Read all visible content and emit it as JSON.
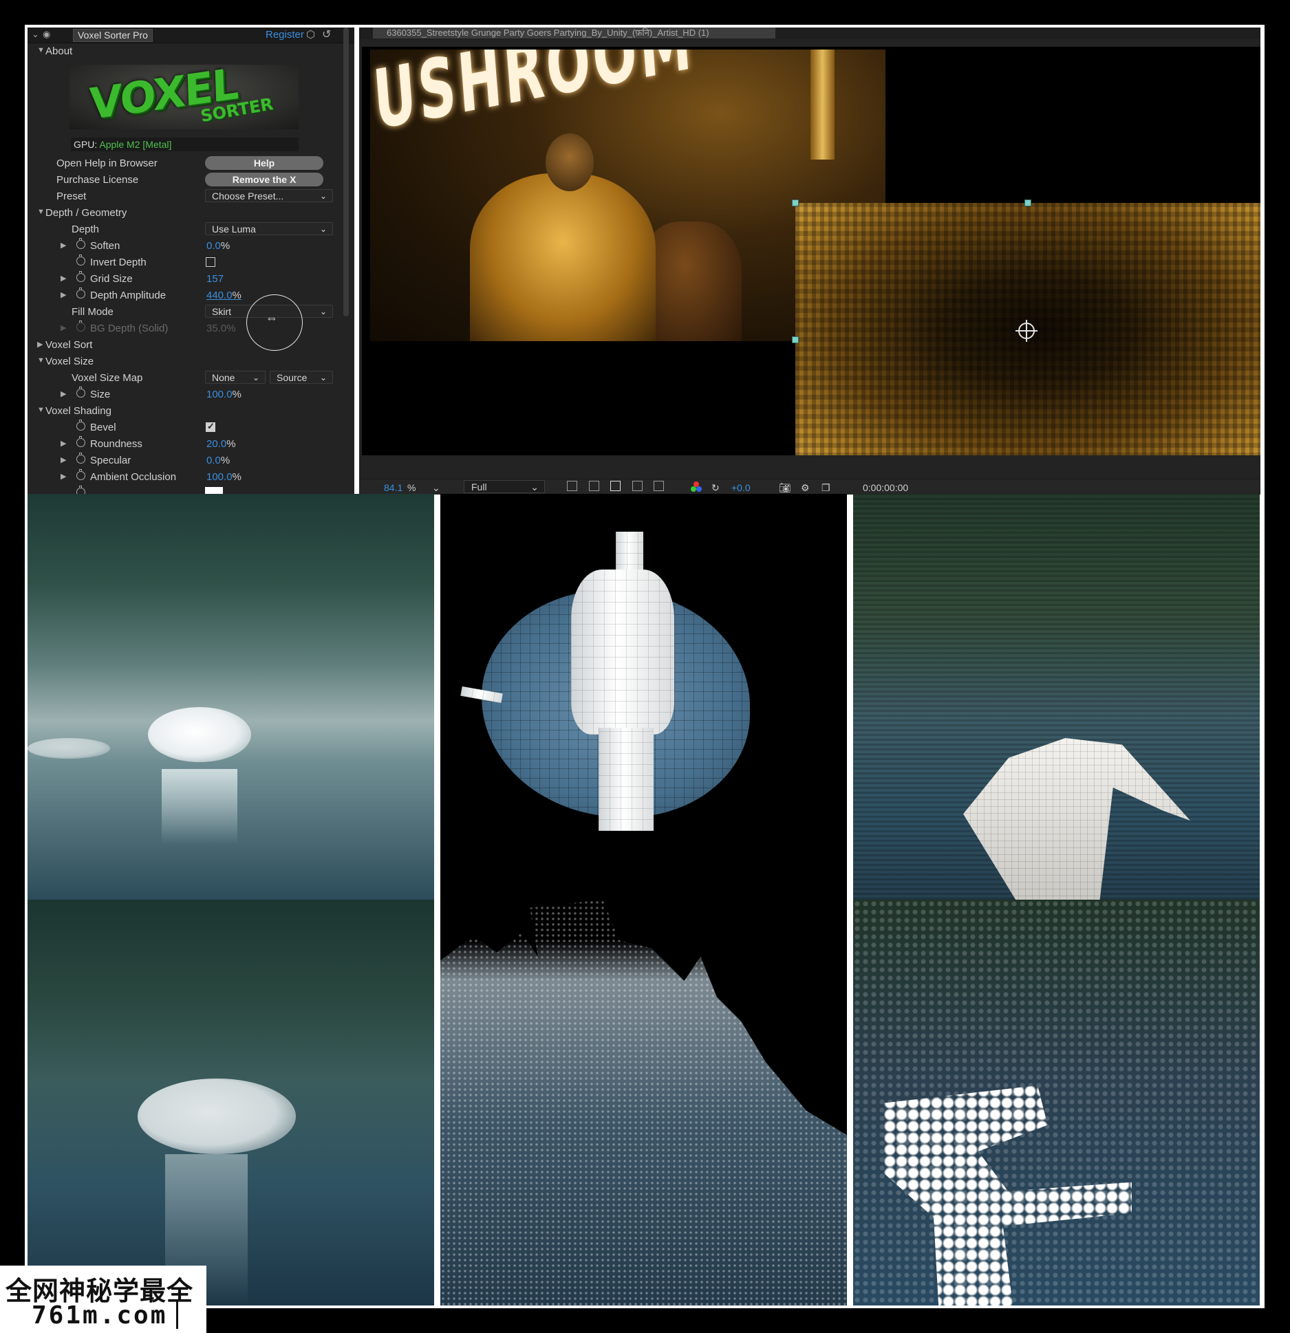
{
  "panel": {
    "title": "Voxel Sorter Pro",
    "register_label": "Register",
    "logo": {
      "word1": "VOXEL",
      "word2": "SORTER"
    },
    "gpu": {
      "label": "GPU:",
      "value": "Apple M2 [Metal]"
    },
    "rows": {
      "about": {
        "label": "About",
        "expanded": true
      },
      "open_help": {
        "label": "Open Help in Browser",
        "button": "Help"
      },
      "purchase": {
        "label": "Purchase License",
        "button": "Remove the X"
      },
      "preset": {
        "label": "Preset",
        "value": "Choose Preset..."
      },
      "depth_geometry": {
        "label": "Depth / Geometry",
        "expanded": true
      },
      "depth": {
        "label": "Depth",
        "value": "Use Luma"
      },
      "soften": {
        "label": "Soften",
        "value": "0.0",
        "unit": "%"
      },
      "invert_depth": {
        "label": "Invert Depth",
        "checked": false
      },
      "grid_size": {
        "label": "Grid Size",
        "value": "157"
      },
      "depth_amplitude": {
        "label": "Depth Amplitude",
        "value": "440.0",
        "unit": "%"
      },
      "fill_mode": {
        "label": "Fill Mode",
        "value": "Skirt"
      },
      "bg_depth": {
        "label": "BG Depth (Solid)",
        "value": "35.0",
        "unit": "%"
      },
      "voxel_sort": {
        "label": "Voxel Sort",
        "expanded": false
      },
      "voxel_size": {
        "label": "Voxel Size",
        "expanded": true
      },
      "voxel_size_map": {
        "label": "Voxel Size Map",
        "value1": "None",
        "value2": "Source"
      },
      "size": {
        "label": "Size",
        "value": "100.0",
        "unit": "%"
      },
      "voxel_shading": {
        "label": "Voxel Shading",
        "expanded": true
      },
      "bevel": {
        "label": "Bevel",
        "checked": true
      },
      "roundness": {
        "label": "Roundness",
        "value": "20.0",
        "unit": "%"
      },
      "specular": {
        "label": "Specular",
        "value": "0.0",
        "unit": "%"
      },
      "ambient_occlusion": {
        "label": "Ambient Occlusion",
        "value": "100.0",
        "unit": "%"
      }
    }
  },
  "viewer": {
    "tab_title": "6360355_Streetstyle Grunge Party Goers Partying_By_Unity_(फ़नि)_Artist_HD (1)",
    "sign_text": "USHROOM",
    "footer": {
      "zoom": "84.1",
      "zoom_unit": "%",
      "resolution": "Full",
      "exposure": "+0.0",
      "timecode": "0:00:00:00"
    }
  },
  "watermark": {
    "line1": "全网神秘学最全",
    "line2": "761m.com"
  },
  "colors": {
    "accent_blue": "#3b8fe0",
    "gpu_green": "#4fc14f",
    "panel_bg": "#232323",
    "logo_green": "#3cba2d"
  }
}
